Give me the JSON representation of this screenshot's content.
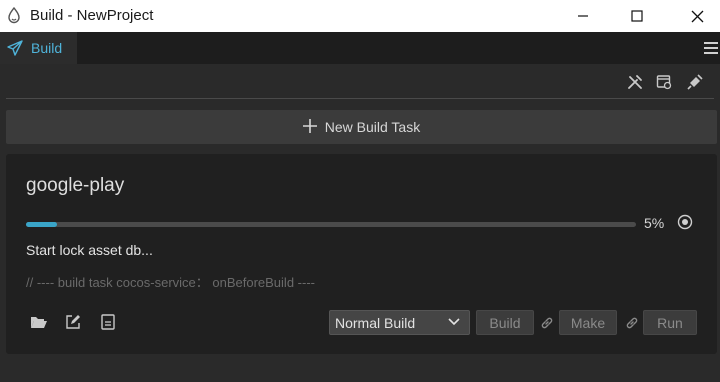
{
  "window": {
    "title": "Build - NewProject"
  },
  "tab": {
    "label": "Build"
  },
  "toolbar": {
    "icons": [
      "tools-icon",
      "preview-icon",
      "satellite-icon"
    ]
  },
  "new_task": {
    "label": "New Build Task"
  },
  "task": {
    "name": "google-play",
    "progress_percent": 5,
    "progress_label": "5%",
    "status": "Start lock asset db...",
    "log": "// ---- build task cocos-service： onBeforeBuild ----",
    "build_mode": "Normal Build",
    "buttons": {
      "build": "Build",
      "make": "Make",
      "run": "Run"
    }
  },
  "colors": {
    "accent": "#3aa5c8",
    "tab_text": "#4fb3d9"
  }
}
